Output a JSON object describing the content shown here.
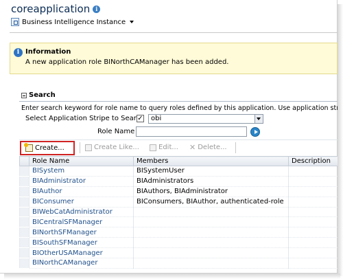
{
  "header": {
    "app_title": "coreapplication",
    "instance_label": "Business Intelligence Instance"
  },
  "info": {
    "title": "Information",
    "message": "A new application role BINorthCAManager has been added."
  },
  "search": {
    "title": "Search",
    "description": "Enter search keyword for role name to query roles defined by this application. Use application stripe to s",
    "stripe_label": "Select Application Stripe to Search",
    "stripe_checked_mark": "✓",
    "stripe_value": "obi",
    "role_name_label": "Role Name",
    "role_name_value": ""
  },
  "toolbar": {
    "create_label": "Create...",
    "create_like_label": "Create Like...",
    "edit_label": "Edit...",
    "delete_label": "Delete..."
  },
  "table": {
    "columns": [
      "Role Name",
      "Members",
      "Description"
    ],
    "rows": [
      {
        "role": "BISystem",
        "members": "BISystemUser",
        "description": ""
      },
      {
        "role": "BIAdministrator",
        "members": "BIAdministrators",
        "description": ""
      },
      {
        "role": "BIAuthor",
        "members": "BIAuthors, BIAdministrator",
        "description": ""
      },
      {
        "role": "BIConsumer",
        "members": "BIConsumers, BIAuthor, authenticated-role",
        "description": ""
      },
      {
        "role": "BIWebCatAdministrator",
        "members": "",
        "description": ""
      },
      {
        "role": "BICentralSFManager",
        "members": "",
        "description": ""
      },
      {
        "role": "BINorthSFManager",
        "members": "",
        "description": ""
      },
      {
        "role": "BISouthSFManager",
        "members": "",
        "description": ""
      },
      {
        "role": "BIOtherUSAManager",
        "members": "",
        "description": ""
      },
      {
        "role": "BINorthCAManager",
        "members": "",
        "description": ""
      }
    ]
  }
}
